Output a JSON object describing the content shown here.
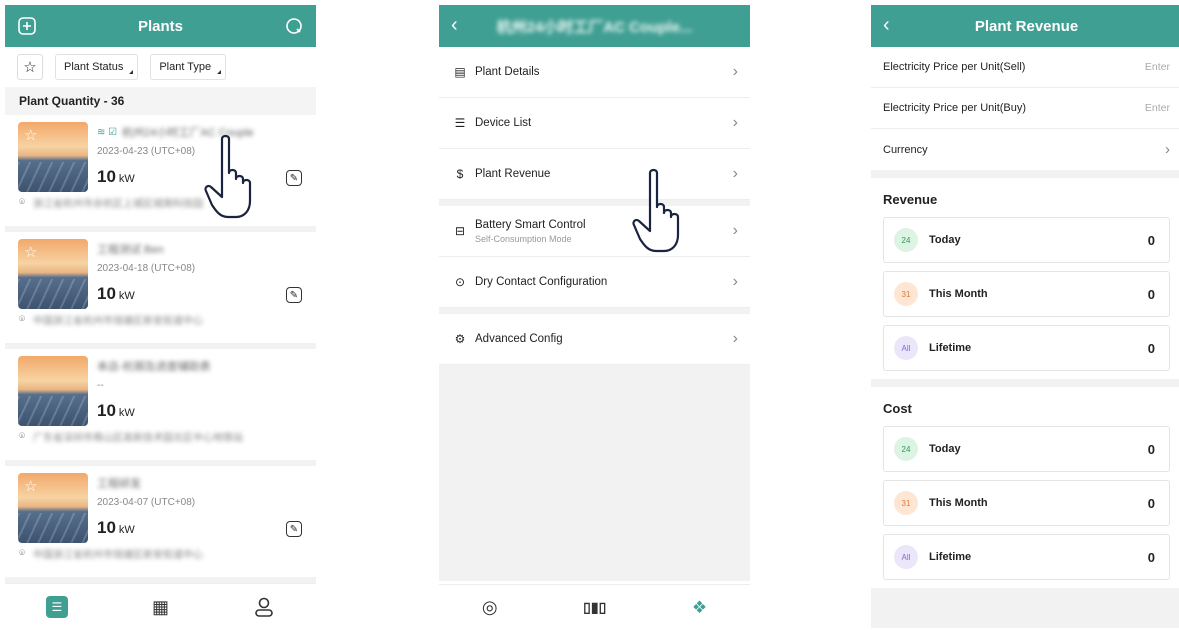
{
  "screen1": {
    "title": "Plants",
    "filters": {
      "status": "Plant Status",
      "type": "Plant Type"
    },
    "quantity": "Plant Quantity - 36",
    "plants": [
      {
        "name": "杭州24小时工厂AC Couple",
        "date": "2023-04-23 (UTC+08)",
        "power": "10",
        "unit": "kW",
        "address": "浙江省杭州市余杭区上城区城南科技园"
      },
      {
        "name": "工程测试 Ben",
        "date": "2023-04-18 (UTC+08)",
        "power": "10",
        "unit": "kW",
        "address": "中国浙江省杭州市钱塘区新安街道中心"
      },
      {
        "name": "本店-杭钢及进度辅助表",
        "date": "--",
        "power": "10",
        "unit": "kW",
        "address": "广东省深圳市南山区高新技术园北区中心地铁站"
      },
      {
        "name": "工程研发",
        "date": "2023-04-07 (UTC+08)",
        "power": "10",
        "unit": "kW",
        "address": "中国浙江省杭州市钱塘区新安街道中心"
      }
    ]
  },
  "screen2": {
    "title": "杭州24小时工厂AC Couple...",
    "items": [
      {
        "label": "Plant Details",
        "icon": "document-icon"
      },
      {
        "label": "Device List",
        "icon": "list-icon"
      },
      {
        "label": "Plant Revenue",
        "icon": "dollar-icon"
      },
      {
        "label": "Battery Smart Control",
        "sub": "Self-Consumption Mode",
        "icon": "battery-icon"
      },
      {
        "label": "Dry Contact Configuration",
        "icon": "contact-icon"
      },
      {
        "label": "Advanced Config",
        "icon": "gear-icon"
      }
    ]
  },
  "screen3": {
    "title": "Plant Revenue",
    "price_sell": {
      "label": "Electricity Price per Unit(Sell)",
      "value": "Enter"
    },
    "price_buy": {
      "label": "Electricity Price per Unit(Buy)",
      "value": "Enter"
    },
    "currency": {
      "label": "Currency"
    },
    "revenue": {
      "title": "Revenue",
      "today": {
        "label": "Today",
        "value": "0"
      },
      "month": {
        "label": "This Month",
        "value": "0"
      },
      "lifetime": {
        "label": "Lifetime",
        "value": "0"
      }
    },
    "cost": {
      "title": "Cost",
      "today": {
        "label": "Today",
        "value": "0"
      },
      "month": {
        "label": "This Month",
        "value": "0"
      },
      "lifetime": {
        "label": "Lifetime",
        "value": "0"
      }
    },
    "badges": {
      "today": "24",
      "month": "31",
      "lifetime": "All"
    }
  },
  "colors": {
    "accent": "#3f9f93"
  }
}
